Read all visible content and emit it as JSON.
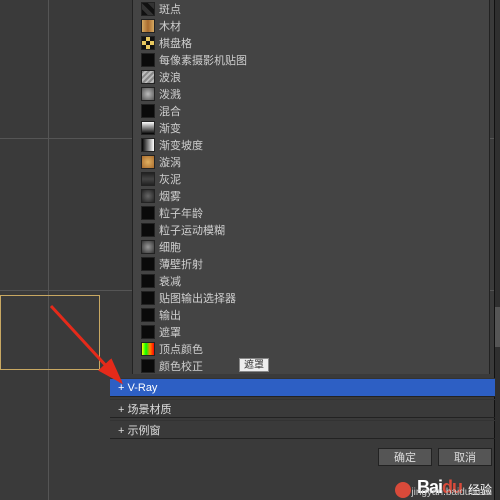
{
  "list": {
    "items": [
      {
        "label": "斑点",
        "swatch": "spots"
      },
      {
        "label": "木材",
        "swatch": "wood"
      },
      {
        "label": "棋盘格",
        "swatch": "checker"
      },
      {
        "label": "每像素摄影机贴图",
        "swatch": "black"
      },
      {
        "label": "波浪",
        "swatch": "waves"
      },
      {
        "label": "泼溅",
        "swatch": "splat"
      },
      {
        "label": "混合",
        "swatch": "black"
      },
      {
        "label": "渐变",
        "swatch": "grad1"
      },
      {
        "label": "渐变坡度",
        "swatch": "grad2"
      },
      {
        "label": "漩涡",
        "swatch": "swirl"
      },
      {
        "label": "灰泥",
        "swatch": "stucco"
      },
      {
        "label": "烟雾",
        "swatch": "smoke"
      },
      {
        "label": "粒子年龄",
        "swatch": "black"
      },
      {
        "label": "粒子运动模糊",
        "swatch": "black"
      },
      {
        "label": "细胞",
        "swatch": "cell"
      },
      {
        "label": "薄壁折射",
        "swatch": "black"
      },
      {
        "label": "衰减",
        "swatch": "black"
      },
      {
        "label": "贴图输出选择器",
        "swatch": "black"
      },
      {
        "label": "输出",
        "swatch": "black"
      },
      {
        "label": "遮罩",
        "swatch": "black"
      },
      {
        "label": "顶点颜色",
        "swatch": "rainbow"
      },
      {
        "label": "颜色校正",
        "swatch": "black",
        "tooltip": "遮罩"
      }
    ]
  },
  "groups": [
    {
      "label": "+ V-Ray",
      "selected": true
    },
    {
      "label": "+ 场景材质",
      "selected": false
    },
    {
      "label": "+ 示例窗",
      "selected": false
    }
  ],
  "buttons": {
    "ok": "确定",
    "cancel": "取消"
  },
  "watermark": {
    "brand_a": "Bai",
    "brand_b": "经验",
    "url": "jingyan.baidu.com"
  },
  "swatch_colors": {
    "black": "#0a0a0a",
    "spots": "linear-gradient(45deg,#111 25%,#333 25%,#333 50%,#111 50%,#111 75%,#333 75%)",
    "wood": "linear-gradient(90deg,#d6a860,#a86b2e,#d6a860)",
    "checker": "repeating-conic-gradient(#e8c860 0 25%,#111 0 50%)",
    "waves": "repeating-linear-gradient(135deg,#888 0 2px,#bbb 2px 4px)",
    "splat": "radial-gradient(#bbb,#555)",
    "grad1": "linear-gradient(#fff,#000)",
    "grad2": "linear-gradient(90deg,#000,#fff)",
    "swirl": "radial-gradient(circle,#e0b060,#a86b2e)",
    "stucco": "linear-gradient(#222,#444,#222)",
    "smoke": "radial-gradient(#666,#222)",
    "cell": "radial-gradient(#999,#333)",
    "rainbow": "linear-gradient(90deg,#ff0,#0f0,#f80,#f00)"
  }
}
